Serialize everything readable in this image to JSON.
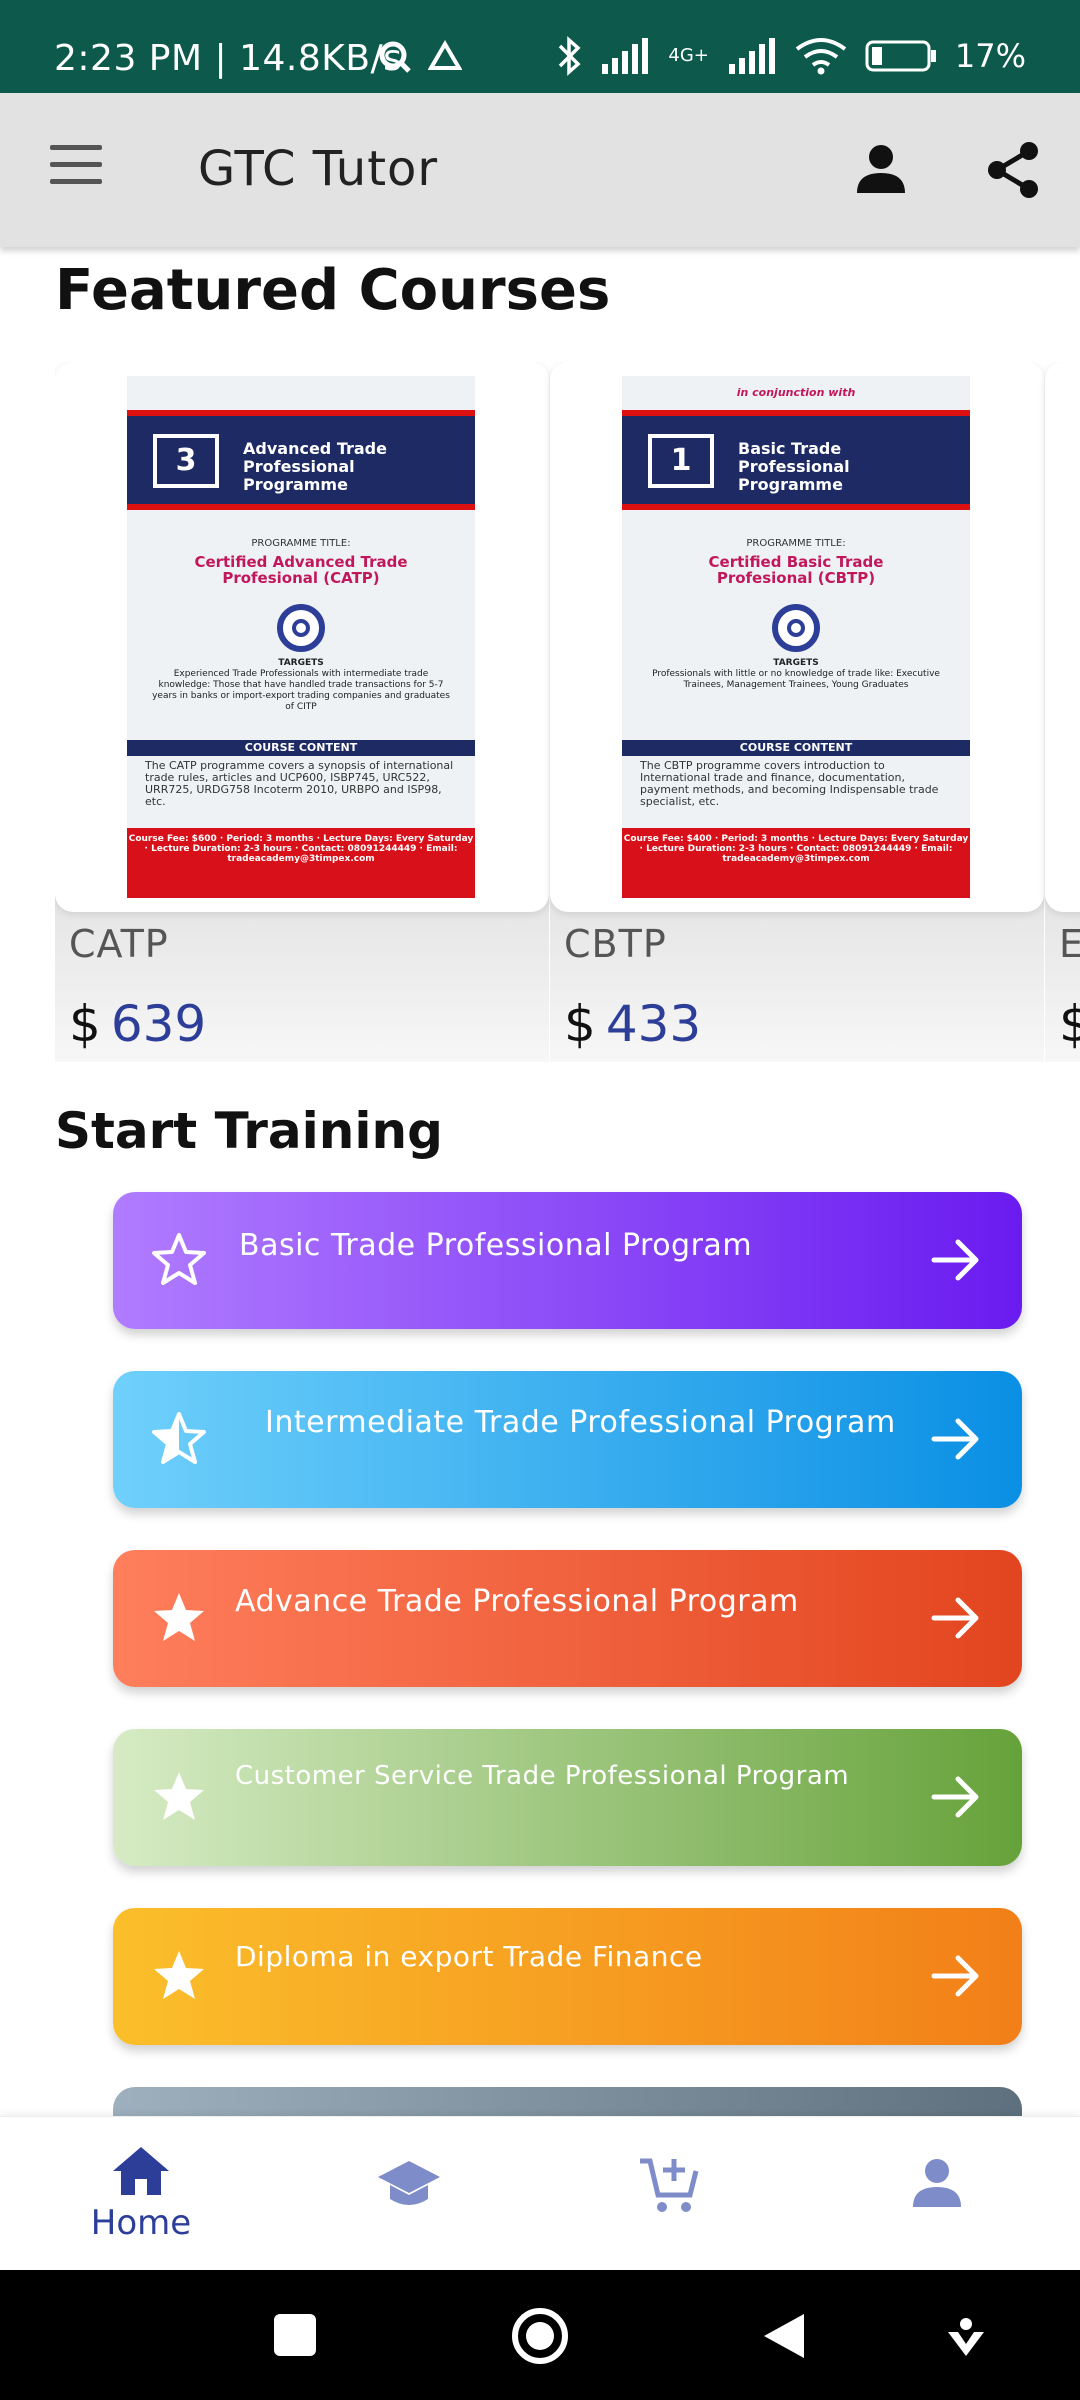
{
  "status_bar": {
    "time": "2:23 PM | 14.8KB/s",
    "network": "4G+",
    "battery": "17%"
  },
  "app_bar": {
    "title": "GTC Tutor"
  },
  "featured": {
    "heading": "Featured Courses",
    "courses": [
      {
        "name": "CATP",
        "currency": "$",
        "price": "639",
        "poster": {
          "number": "3",
          "band_title": "Advanced Trade Professional Programme",
          "programme_label": "PROGRAMME TITLE:",
          "cert_title": "Certified Advanced Trade Profesional (CATP)",
          "targets_label": "TARGETS",
          "targets_text": "Experienced Trade Professionals with intermediate trade knowledge: Those that have handled trade transactions for 5-7 years in banks or import-export trading companies and graduates of CITP",
          "content_label": "COURSE CONTENT",
          "content_text": "The CATP programme covers a synopsis of international trade rules, articles and UCP600, ISBP745, URC522, URR725, URDG758 Incoterm 2010, URBPO and ISP98, etc.",
          "fee_text": "Course Fee: $600 · Period: 3 months · Lecture Days: Every Saturday · Lecture Duration: 2-3 hours · Contact: 08091244449 · Email: tradeacademy@3timpex.com"
        }
      },
      {
        "name": "CBTP",
        "currency": "$",
        "price": "433",
        "poster": {
          "top_text": "in conjunction with",
          "number": "1",
          "band_title": "Basic Trade Professional Programme",
          "programme_label": "PROGRAMME TITLE:",
          "cert_title": "Certified Basic Trade Profesional (CBTP)",
          "targets_label": "TARGETS",
          "targets_text": "Professionals with little or no knowledge of trade like: Executive Trainees, Management Trainees, Young Graduates",
          "content_label": "COURSE CONTENT",
          "content_text": "The CBTP programme covers introduction to International trade and finance, documentation, payment methods, and becoming Indispensable trade specialist, etc.",
          "fee_text": "Course Fee: $400 · Period: 3 months · Lecture Days: Every Saturday · Lecture Duration: 2-3 hours · Contact: 08091244449 · Email: tradeacademy@3timpex.com"
        }
      },
      {
        "name": "E",
        "currency": "$",
        "price": ""
      }
    ]
  },
  "training": {
    "heading": "Start Training",
    "programs": [
      {
        "label": "Basic Trade Professional Program",
        "icon": "star-outline-icon",
        "colors": [
          "#b07cff",
          "#6a1bf0"
        ]
      },
      {
        "label": "Intermediate Trade Professional Program",
        "icon": "star-half-icon",
        "colors": [
          "#6fd0fb",
          "#0a8fe4"
        ]
      },
      {
        "label": "Advance Trade Professional Program",
        "icon": "star-filled-icon",
        "colors": [
          "#ff7e5c",
          "#e2451f"
        ]
      },
      {
        "label": "Customer Service Trade Professional Program",
        "icon": "star-filled-icon",
        "colors": [
          "#d6ebc4",
          "#66a23a"
        ]
      },
      {
        "label": "Diploma in export Trade Finance",
        "icon": "star-filled-icon",
        "colors": [
          "#fbbf2b",
          "#f27f18"
        ]
      }
    ]
  },
  "bottom_nav": {
    "items": [
      {
        "label": "Home",
        "icon": "home-icon"
      },
      {
        "label": "",
        "icon": "school-icon"
      },
      {
        "label": "",
        "icon": "cart-add-icon"
      },
      {
        "label": "",
        "icon": "person-icon"
      }
    ]
  },
  "colors": {
    "status_bar": "#0d5a4c",
    "app_bar": "#e2e2e2",
    "accent": "#2c3e98"
  }
}
